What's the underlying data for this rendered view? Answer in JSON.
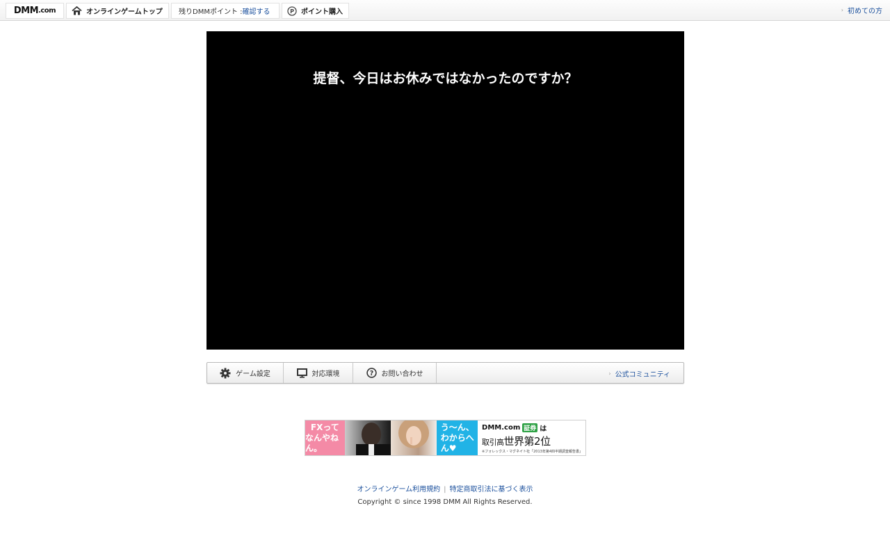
{
  "header": {
    "logo": "DMM",
    "logo_suffix": ".com",
    "game_top": "オンラインゲームトップ",
    "points_label": "残りDMMポイント : ",
    "points_link": "確認する",
    "buy_points": "ポイント購入",
    "first_time": "初めての方"
  },
  "game": {
    "message": "提督、今日はお休みではなかったのですか？"
  },
  "toolbar": {
    "settings": "ゲーム設定",
    "environment": "対応環境",
    "contact": "お問い合わせ",
    "community": "公式コミュニティ"
  },
  "banner": {
    "left_line1": "FXって",
    "left_line2": "なんやねん。",
    "mid_line1": "う〜ん、",
    "mid_line2": "わからへん♥",
    "brand": "DMM.com",
    "brand_badge": "証券",
    "brand_suffix": "は",
    "rank_prefix": "取引高",
    "rank_main": "世界第2位",
    "note": "※フォレックス・マグネイト社「2013年第4四半期調査報告書」",
    "colors": {
      "pink": "#f48aa6",
      "cyan": "#21b3e6",
      "green": "#2da144"
    }
  },
  "footer": {
    "terms": "オンラインゲーム利用規約",
    "separator": "|",
    "law": "特定商取引法に基づく表示",
    "copyright": "Copyright © since 1998 DMM All Rights Reserved."
  },
  "colors": {
    "link": "#1a4f9c",
    "game_bg": "#000000"
  }
}
